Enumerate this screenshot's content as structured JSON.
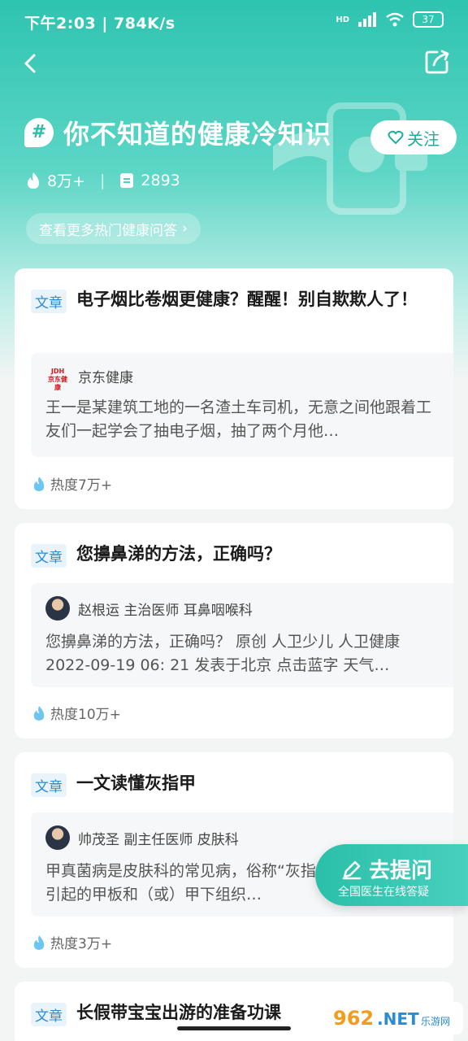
{
  "status": {
    "time_speed": "下午2:03 | 784K/s",
    "battery": "37",
    "network": "HD"
  },
  "topic": {
    "hash": "#",
    "title": "你不知道的健康冷知识",
    "follow_label": "关注"
  },
  "stats": {
    "heat": "8万+",
    "posts": "2893"
  },
  "more_link": "查看更多热门健康问答",
  "cards": [
    {
      "tag": "文章",
      "title": "电子烟比卷烟更健康？醒醒！别自欺欺人了！",
      "author": "京东健康",
      "logo_text": "JDH 京东健康",
      "text": "王一是某建筑工地的一名渣土车司机，无意之间他跟着工友们一起学会了抽电子烟，抽了两个月他…",
      "heat": "热度7万+"
    },
    {
      "tag": "文章",
      "title": "您擤鼻涕的方法，正确吗？",
      "author": "赵根运 主治医师 耳鼻咽喉科",
      "text": "您擤鼻涕的方法，正确吗？ 原创 人卫少儿 人卫健康 2022-09-19 06: 21 发表于北京 点击蓝字 天气…",
      "heat": "热度10万+"
    },
    {
      "tag": "文章",
      "title": "一文读懂灰指甲",
      "author": "帅茂圣 副主任医师 皮肤科",
      "text": "甲真菌病是皮肤科的常见病，俗称“灰指甲”，是一种真菌引起的甲板和（或）甲下组织…",
      "heat": "热度3万+"
    },
    {
      "tag": "文章",
      "title": "长假带宝宝出游的准备功课"
    }
  ],
  "fab": {
    "label": "去提问",
    "sub": "全国医生在线答疑"
  },
  "watermark": "962.NET 乐游网",
  "colors": {
    "accent": "#2bbfa9",
    "tag_blue": "#2a8bd6"
  }
}
